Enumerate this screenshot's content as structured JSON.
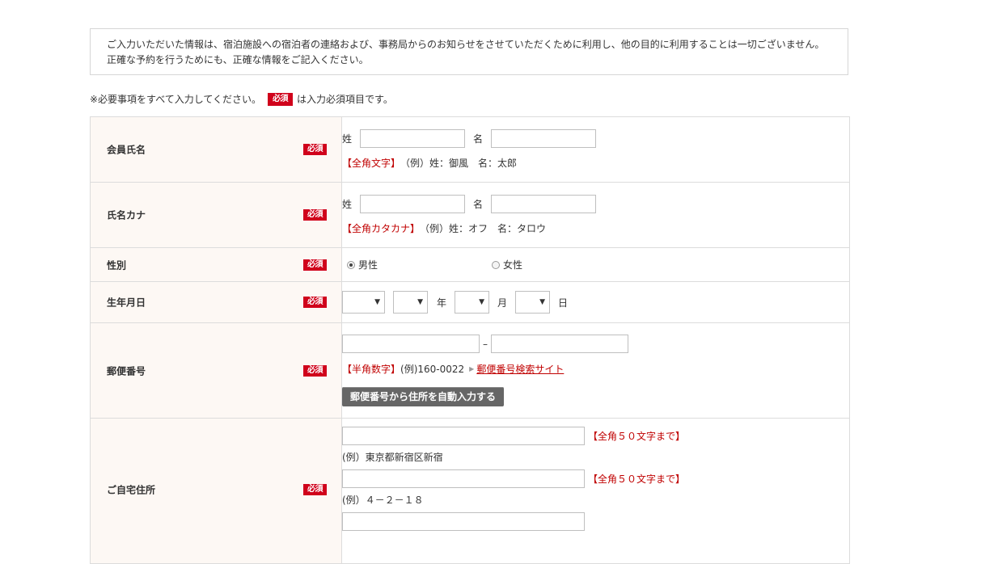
{
  "notice": {
    "line1": "ご入力いただいた情報は、宿泊施設への宿泊者の連絡および、事務局からのお知らせをさせていただくために利用し、他の目的に利用することは一切ございません。",
    "line2": "正確な予約を行うためにも、正確な情報をご記入ください。"
  },
  "legend": {
    "prefix": "※必要事項をすべて入力してください。",
    "badge": "必須",
    "suffix": "は入力必須項目です。"
  },
  "required_badge": "必須",
  "rows": {
    "name": {
      "label": "会員氏名",
      "last_label": "姓",
      "first_label": "名",
      "last_value": "",
      "first_value": "",
      "note_tag": "【全角文字】",
      "note_text": "（例）姓：御風　名：太郎"
    },
    "kana": {
      "label": "氏名カナ",
      "last_label": "姓",
      "first_label": "名",
      "last_value": "",
      "first_value": "",
      "note_tag": "【全角カタカナ】",
      "note_text": "（例）姓：オフ　名：タロウ"
    },
    "gender": {
      "label": "性別",
      "options": [
        "男性",
        "女性"
      ],
      "selected": "男性"
    },
    "birthday": {
      "label": "生年月日",
      "year_unit": "年",
      "month_unit": "月",
      "day_unit": "日",
      "era_value": "",
      "year_value": "",
      "month_value": "",
      "day_value": ""
    },
    "postal": {
      "label": "郵便番号",
      "part1": "",
      "part2": "",
      "separator": "–",
      "note_tag": "【半角数字】",
      "note_text": "(例)160-0022",
      "link_text": "郵便番号検索サイト",
      "autofill_button": "郵便番号から住所を自動入力する"
    },
    "address": {
      "label": "ご自宅住所",
      "line1_value": "",
      "line1_limit": "【全角５０文字まで】",
      "line1_example": "(例）東京都新宿区新宿",
      "line2_value": "",
      "line2_limit": "【全角５０文字まで】",
      "line2_example": "(例）４－２－１８"
    }
  },
  "colors": {
    "required_red": "#d0021b",
    "label_bg": "#fdf8f4",
    "note_red": "#c00000"
  }
}
